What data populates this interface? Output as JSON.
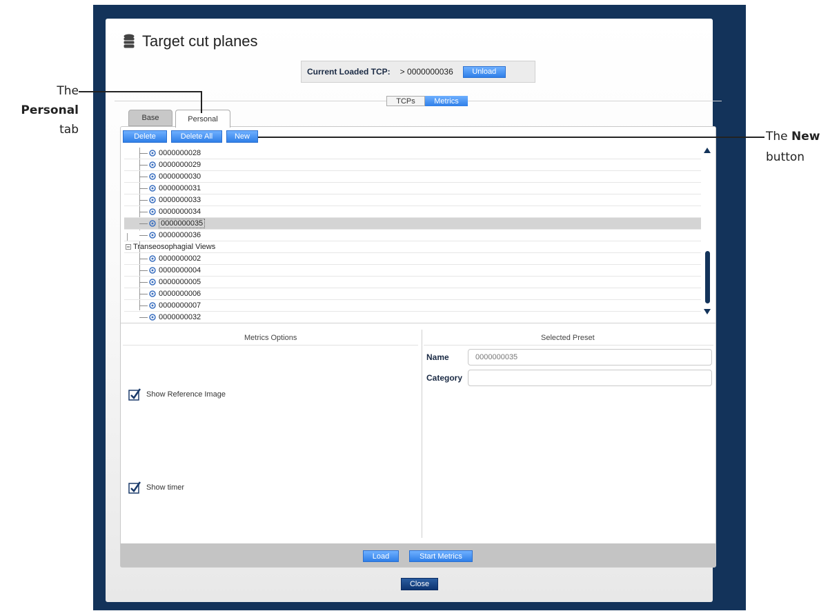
{
  "window": {
    "title": "Target cut planes",
    "icon": "database-icon"
  },
  "loaded_tcp": {
    "label": "Current Loaded TCP:",
    "value": "> 0000000036",
    "unload_label": "Unload"
  },
  "view_toggle": {
    "options": [
      "TCPs",
      "Metrics"
    ],
    "selected": "Metrics"
  },
  "tabs": [
    {
      "label": "Base"
    },
    {
      "label": "Personal",
      "active": true
    }
  ],
  "toolbar": {
    "delete_label": "Delete",
    "delete_all_label": "Delete All",
    "new_label": "New"
  },
  "tree": {
    "group_label": "Transeosophagial Views",
    "items_before": [
      "0000000028",
      "0000000029",
      "0000000030",
      "0000000031",
      "0000000033",
      "0000000034",
      "0000000035",
      "0000000036"
    ],
    "selected": "0000000035",
    "items_after": [
      "0000000002",
      "0000000004",
      "0000000005",
      "0000000006",
      "0000000007",
      "0000000032"
    ]
  },
  "metrics_options": {
    "title": "Metrics Options",
    "show_reference_label": "Show Reference Image",
    "show_reference_checked": true,
    "show_timer_label": "Show timer",
    "show_timer_checked": true
  },
  "selected_preset": {
    "title": "Selected Preset",
    "name_label": "Name",
    "name_value": "0000000035",
    "category_label": "Category",
    "category_value": ""
  },
  "footer": {
    "load_label": "Load",
    "start_metrics_label": "Start Metrics",
    "close_label": "Close"
  },
  "callouts": {
    "personal_l1": "The",
    "personal_l2": "Personal",
    "personal_l3": "tab",
    "new_l1_prefix": "The ",
    "new_l1_bold": "New",
    "new_l2": "button"
  },
  "colors": {
    "frame": "#13335a",
    "accent": "#2f7fe8"
  }
}
